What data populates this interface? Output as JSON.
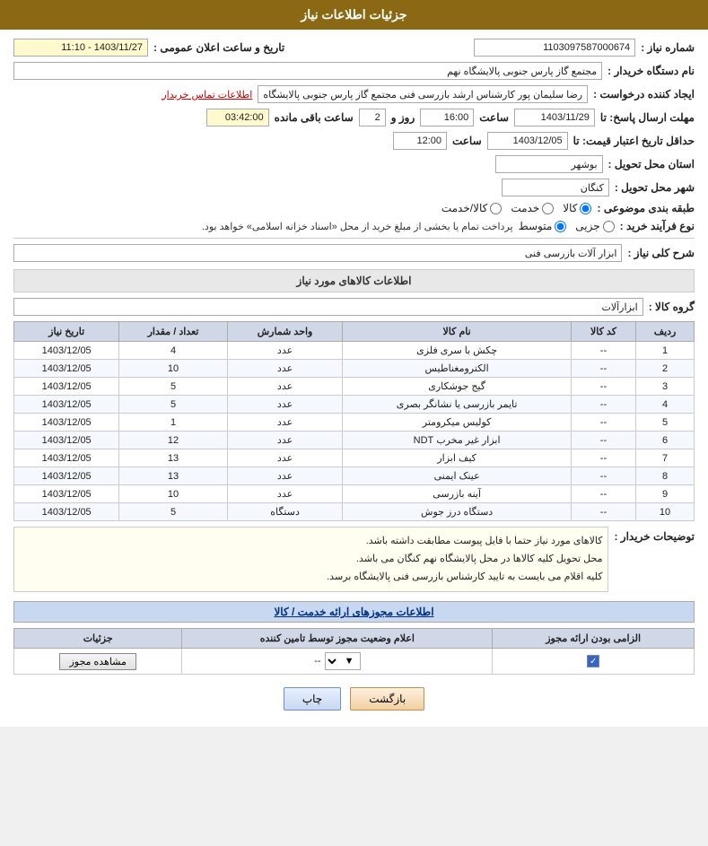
{
  "header": {
    "title": "جزئیات اطلاعات نیاز"
  },
  "fields": {
    "order_number_label": "شماره نیاز :",
    "order_number_value": "1103097587000674",
    "buyer_label": "نام دستگاه خریدار :",
    "buyer_value": "مجتمع گاز پارس جنوبی  پالایشگاه نهم",
    "creator_label": "ایجاد کننده درخواست :",
    "creator_value": "رضا سلیمان پور کارشناس ارشد بازرسی فنی مجتمع گاز پارس جنوبی  پالایشگاه",
    "contact_label": "اطلاعات تماس خریدار",
    "reply_deadline_label": "مهلت ارسال پاسخ: تا",
    "reply_date_value": "1403/11/29",
    "reply_time_label": "ساعت",
    "reply_time_value": "16:00",
    "reply_days_label": "روز و",
    "reply_days_value": "2",
    "reply_remaining_label": "ساعت باقی مانده",
    "reply_remaining_value": "03:42:00",
    "date_label_row1": "تاریخ و ساعت اعلان عمومی :",
    "date_value_row1": "1403/11/27 - 11:10",
    "price_deadline_label": "حداقل تاریخ اعتبار قیمت: تا",
    "price_date_value": "1403/12/05",
    "price_time_label": "ساعت",
    "price_time_value": "12:00",
    "province_label": "استان محل تحویل :",
    "province_value": "بوشهر",
    "city_label": "شهر محل تحویل :",
    "city_value": "کنگان",
    "category_label": "طبقه بندی موضوعی :",
    "category_options": [
      "کالا",
      "خدمت",
      "کالا/خدمت"
    ],
    "category_selected": "کالا",
    "purchase_type_label": "نوع فرآیند خرید :",
    "purchase_type_options": [
      "جزیی",
      "متوسط"
    ],
    "purchase_type_note": "پرداخت تمام یا بخشی از مبلغ خرید از محل «اسناد خزانه اسلامی» خواهد بود.",
    "description_label": "شرح کلی نیاز :",
    "description_value": "ابزار آلات بازرسی فنی",
    "goods_section_title": "اطلاعات کالاهای مورد نیاز",
    "goods_group_label": "گروه کالا :",
    "goods_group_value": "ابزارآلات",
    "table_headers": [
      "ردیف",
      "کد کالا",
      "نام کالا",
      "واحد شمارش",
      "تعداد / مقدار",
      "تاریخ نیاز"
    ],
    "table_rows": [
      {
        "row": "1",
        "code": "--",
        "name": "چکش با سری فلزی",
        "unit": "عدد",
        "qty": "4",
        "date": "1403/12/05"
      },
      {
        "row": "2",
        "code": "--",
        "name": "الکترومغناطیس",
        "unit": "عدد",
        "qty": "10",
        "date": "1403/12/05"
      },
      {
        "row": "3",
        "code": "--",
        "name": "گیج جوشکاری",
        "unit": "عدد",
        "qty": "5",
        "date": "1403/12/05"
      },
      {
        "row": "4",
        "code": "--",
        "name": "تایمر بازرسی یا نشانگر بصری",
        "unit": "عدد",
        "qty": "5",
        "date": "1403/12/05"
      },
      {
        "row": "5",
        "code": "--",
        "name": "کولیس میکرومتر",
        "unit": "عدد",
        "qty": "1",
        "date": "1403/12/05"
      },
      {
        "row": "6",
        "code": "--",
        "name": "ابزار غیر مخرب NDT",
        "unit": "عدد",
        "qty": "12",
        "date": "1403/12/05"
      },
      {
        "row": "7",
        "code": "--",
        "name": "کیف ابزار",
        "unit": "عدد",
        "qty": "13",
        "date": "1403/12/05"
      },
      {
        "row": "8",
        "code": "--",
        "name": "عینک ایمنی",
        "unit": "عدد",
        "qty": "13",
        "date": "1403/12/05"
      },
      {
        "row": "9",
        "code": "--",
        "name": "آینه بازرسی",
        "unit": "عدد",
        "qty": "10",
        "date": "1403/12/05"
      },
      {
        "row": "10",
        "code": "--",
        "name": "دستگاه درز جوش",
        "unit": "دستگاه",
        "qty": "5",
        "date": "1403/12/05"
      }
    ],
    "buyer_notes_label": "توضیحات خریدار :",
    "buyer_notes_lines": [
      "کالاهای مورد نیاز حتما با فایل پیوست مطابقت داشته باشد.",
      "محل تحویل کلیه کالاها در محل پالایشگاه نهم کنگان می باشد.",
      "کلیه اقلام می بایست به تایید کارشناس بازرسی فنی پالایشگاه برسد."
    ],
    "permissions_section_title": "اطلاعات مجوزهای ارائه خدمت / کالا",
    "permissions_table_headers": [
      "الزامی بودن ارائه مجوز",
      "اعلام وضعیت مجوز توسط تامین کننده",
      "جزئیات"
    ],
    "permissions_row": {
      "mandatory": true,
      "status": "--",
      "view_btn": "مشاهده مجوز"
    },
    "btn_print": "چاپ",
    "btn_back": "بازگشت"
  }
}
